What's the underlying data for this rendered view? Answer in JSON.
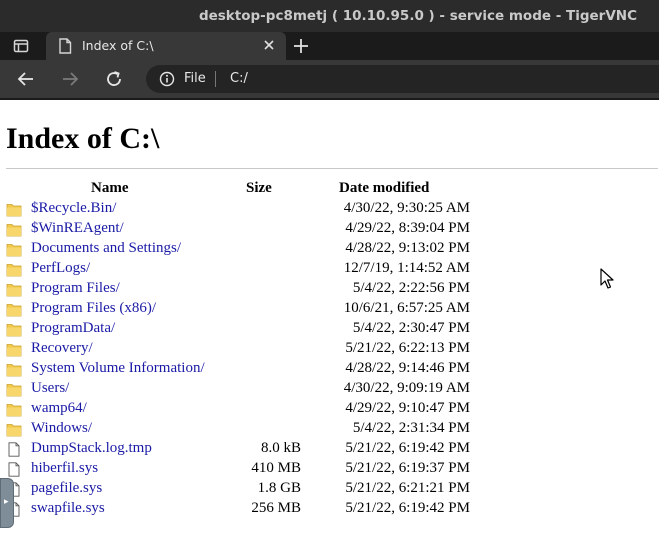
{
  "window": {
    "title": "desktop-pc8metj ( 10.10.95.0 ) - service mode - TigerVNC"
  },
  "browser": {
    "tab_title": "Index of C:\\",
    "url_scheme": "File",
    "url": "C:/"
  },
  "page": {
    "heading": "Index of C:\\",
    "columns": {
      "name": "Name",
      "size": "Size",
      "date": "Date modified"
    },
    "entries": [
      {
        "name": "$Recycle.Bin/",
        "size": "",
        "date": "4/30/22, 9:30:25 AM",
        "type": "folder"
      },
      {
        "name": "$WinREAgent/",
        "size": "",
        "date": "4/29/22, 8:39:04 PM",
        "type": "folder"
      },
      {
        "name": "Documents and Settings/",
        "size": "",
        "date": "4/28/22, 9:13:02 PM",
        "type": "folder"
      },
      {
        "name": "PerfLogs/",
        "size": "",
        "date": "12/7/19, 1:14:52 AM",
        "type": "folder"
      },
      {
        "name": "Program Files/",
        "size": "",
        "date": "5/4/22, 2:22:56 PM",
        "type": "folder"
      },
      {
        "name": "Program Files (x86)/",
        "size": "",
        "date": "10/6/21, 6:57:25 AM",
        "type": "folder"
      },
      {
        "name": "ProgramData/",
        "size": "",
        "date": "5/4/22, 2:30:47 PM",
        "type": "folder"
      },
      {
        "name": "Recovery/",
        "size": "",
        "date": "5/21/22, 6:22:13 PM",
        "type": "folder"
      },
      {
        "name": "System Volume Information/",
        "size": "",
        "date": "4/28/22, 9:14:46 PM",
        "type": "folder"
      },
      {
        "name": "Users/",
        "size": "",
        "date": "4/30/22, 9:09:19 AM",
        "type": "folder"
      },
      {
        "name": "wamp64/",
        "size": "",
        "date": "4/29/22, 9:10:47 PM",
        "type": "folder"
      },
      {
        "name": "Windows/",
        "size": "",
        "date": "5/4/22, 2:31:34 PM",
        "type": "folder"
      },
      {
        "name": "DumpStack.log.tmp",
        "size": "8.0 kB",
        "date": "5/21/22, 6:19:42 PM",
        "type": "file"
      },
      {
        "name": "hiberfil.sys",
        "size": "410 MB",
        "date": "5/21/22, 6:19:37 PM",
        "type": "file"
      },
      {
        "name": "pagefile.sys",
        "size": "1.8 GB",
        "date": "5/21/22, 6:21:21 PM",
        "type": "file"
      },
      {
        "name": "swapfile.sys",
        "size": "256 MB",
        "date": "5/21/22, 6:19:42 PM",
        "type": "file"
      }
    ]
  },
  "colors": {
    "link": "#1a1aa6",
    "folder": "#f2c94c",
    "titlebar": "#2b2b2b",
    "toolbar": "#383838"
  },
  "icons": {
    "tab_actions": "tab-actions-icon",
    "document": "document-icon",
    "close": "close-icon",
    "new_tab": "plus-icon",
    "back": "back-arrow-icon",
    "forward": "forward-arrow-icon",
    "reload": "reload-icon",
    "info": "info-icon",
    "folder": "folder-icon",
    "file": "file-icon",
    "cursor": "mouse-cursor-icon"
  }
}
